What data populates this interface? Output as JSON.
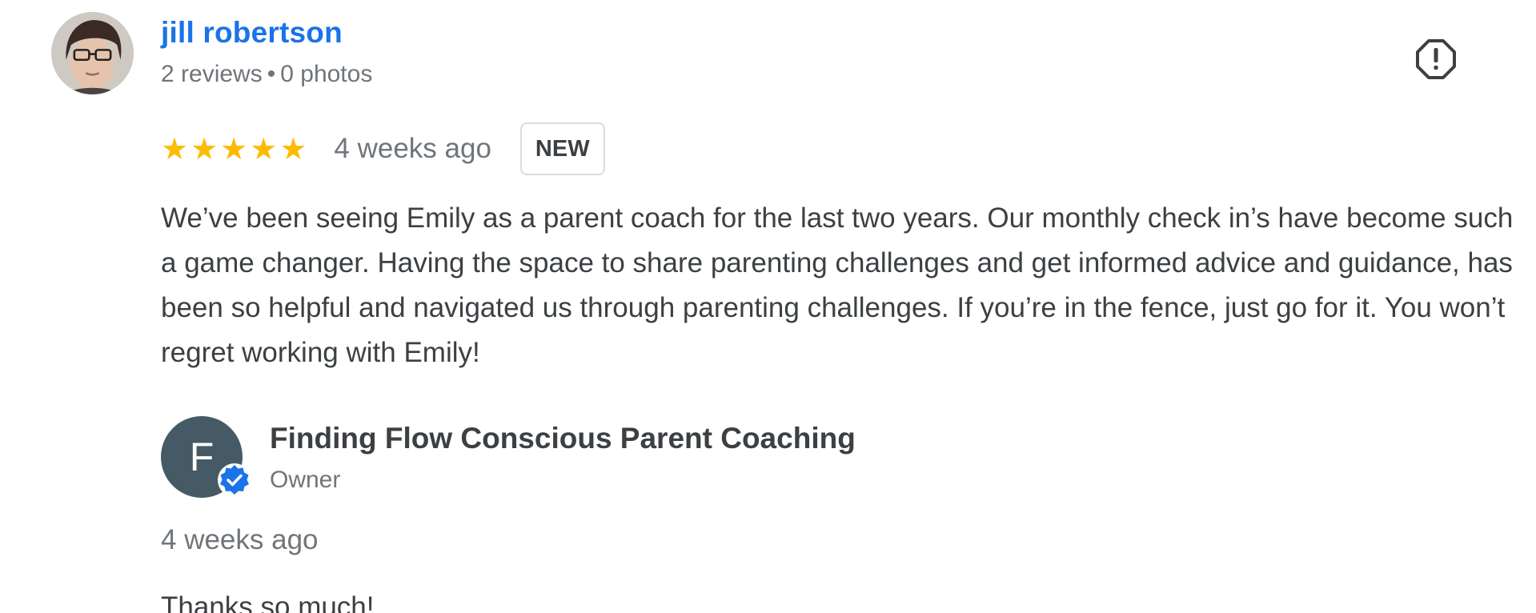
{
  "review": {
    "reviewer": {
      "name": "jill robertson",
      "reviews_count": "2 reviews",
      "separator": "•",
      "photos_count": "0 photos"
    },
    "report_icon": "report-flag-icon",
    "rating": {
      "stars": 5,
      "max_stars": 5,
      "star_glyph": "★",
      "star_color": "#fbbc04"
    },
    "date": "4 weeks ago",
    "badge": "NEW",
    "text": "We’ve been seeing Emily as a parent coach for the last two years. Our monthly check in’s have become such a game changer. Having the space to share parenting challenges and get informed advice and guidance, has been so helpful and navigated us through parenting challenges. If you’re in the fence, just go for it. You won’t regret working with Emily!"
  },
  "owner_reply": {
    "avatar_letter": "F",
    "avatar_color": "#455a64",
    "verified_icon": "verified-check-icon",
    "name": "Finding Flow Conscious Parent Coaching",
    "role": "Owner",
    "date": "4 weeks ago",
    "text": "Thanks so much!"
  },
  "colors": {
    "link_blue": "#1a73e8",
    "secondary_text": "#70757a",
    "primary_text": "#3c4043",
    "verified_blue": "#1a73e8"
  }
}
